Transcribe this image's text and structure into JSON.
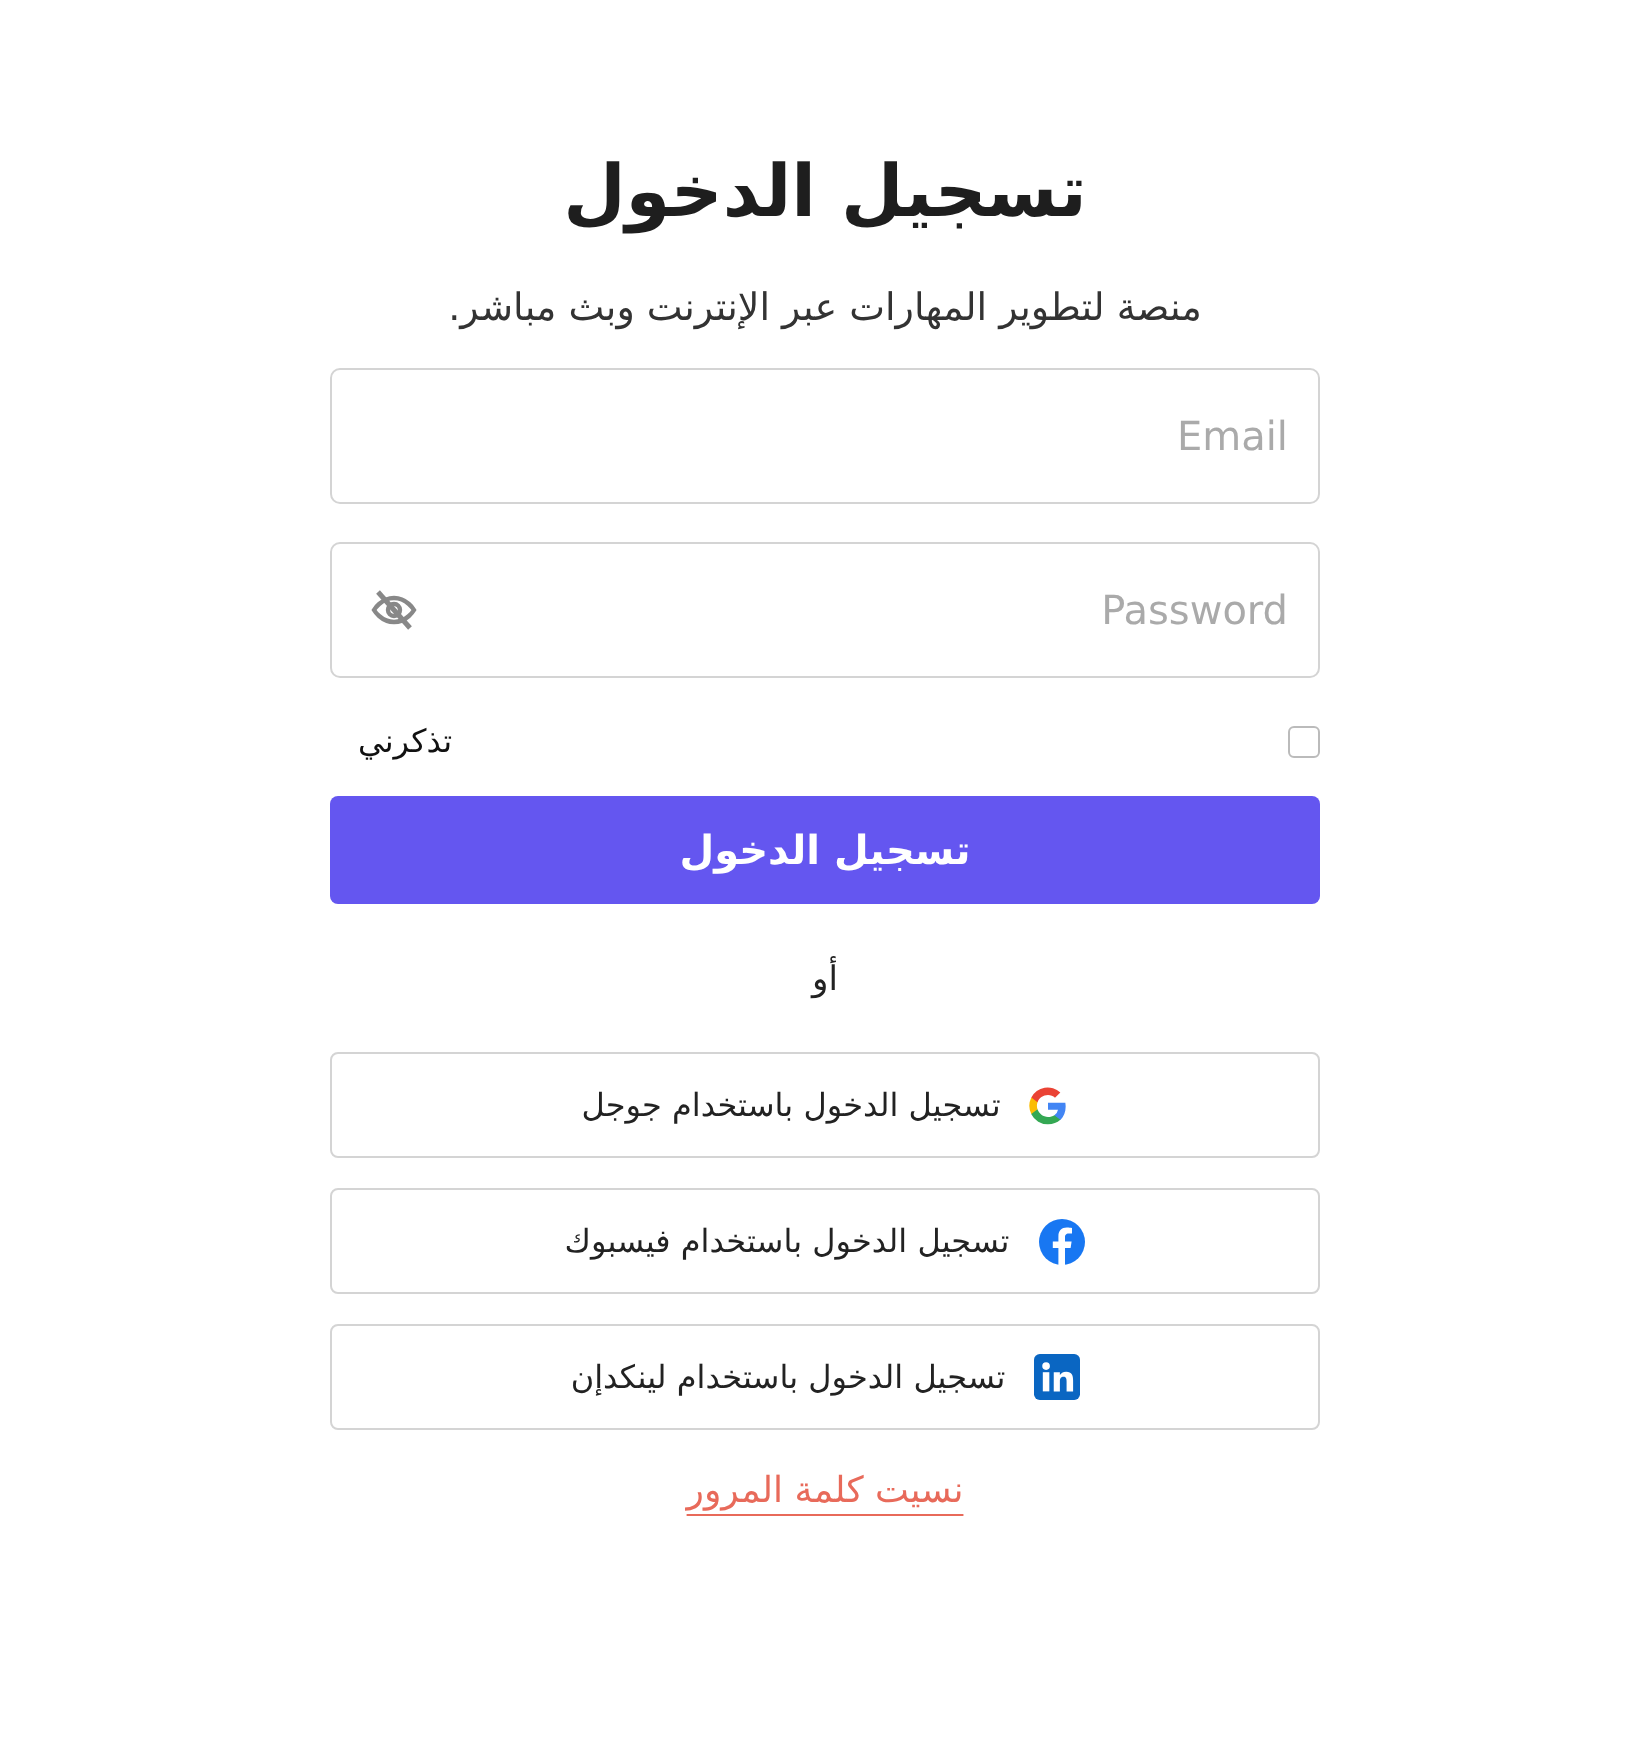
{
  "title": "تسجيل الدخول",
  "subtitle": "منصة لتطوير المهارات عبر الإنترنت وبث مباشر.",
  "fields": [
    {
      "kind": "email",
      "placeholder": "Email"
    },
    {
      "kind": "password",
      "placeholder": "Password"
    }
  ],
  "remember": {
    "label": "تذكرني",
    "checked": false
  },
  "submit": "تسجيل الدخول",
  "separator": "أو",
  "social": [
    {
      "kind": "google",
      "label": "تسجيل الدخول باستخدام جوجل"
    },
    {
      "kind": "facebook",
      "label": "تسجيل الدخول باستخدام فيسبوك"
    },
    {
      "kind": "linkedin",
      "label": "تسجيل الدخول باستخدام لينكدإن"
    }
  ],
  "forgot": "نسيت كلمة المرور"
}
